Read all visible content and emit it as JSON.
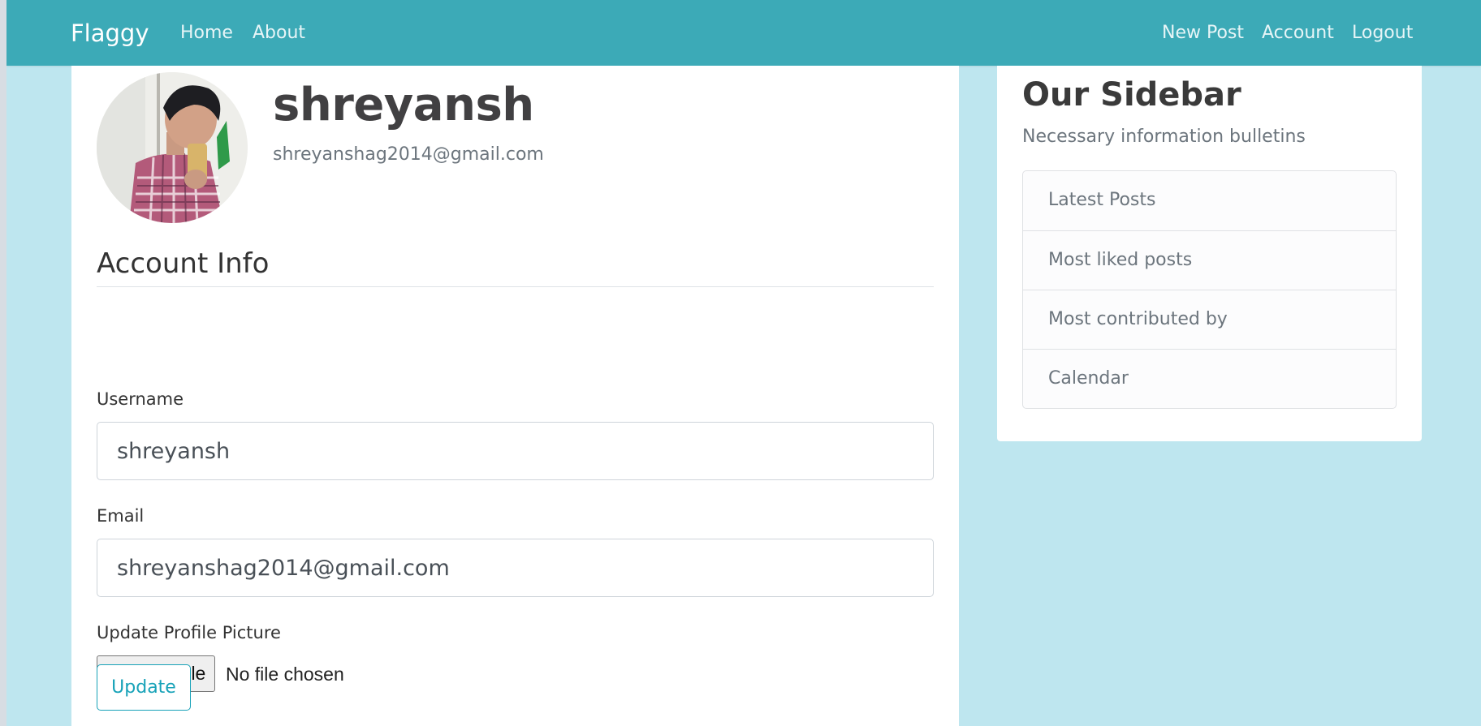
{
  "navbar": {
    "brand": "Flaggy",
    "left_links": [
      "Home",
      "About"
    ],
    "right_links": [
      "New Post",
      "Account",
      "Logout"
    ],
    "color": "#3caab7"
  },
  "profile": {
    "avatar_icon": "user-photo",
    "name": "shreyansh",
    "email": "shreyanshag2014@gmail.com"
  },
  "account_form": {
    "title": "Account Info",
    "username": {
      "label": "Username",
      "value": "shreyansh"
    },
    "email": {
      "label": "Email",
      "value": "shreyanshag2014@gmail.com"
    },
    "picture": {
      "label": "Update Profile Picture",
      "button": "Choose File",
      "status": "No file chosen"
    },
    "submit": "Update",
    "accent_color": "#17a2b8"
  },
  "sidebar": {
    "title": "Our Sidebar",
    "subtitle": "Necessary information bulletins",
    "items": [
      "Latest Posts",
      "Most liked posts",
      "Most contributed by",
      "Calendar"
    ]
  },
  "page_background": "#bee6ef"
}
